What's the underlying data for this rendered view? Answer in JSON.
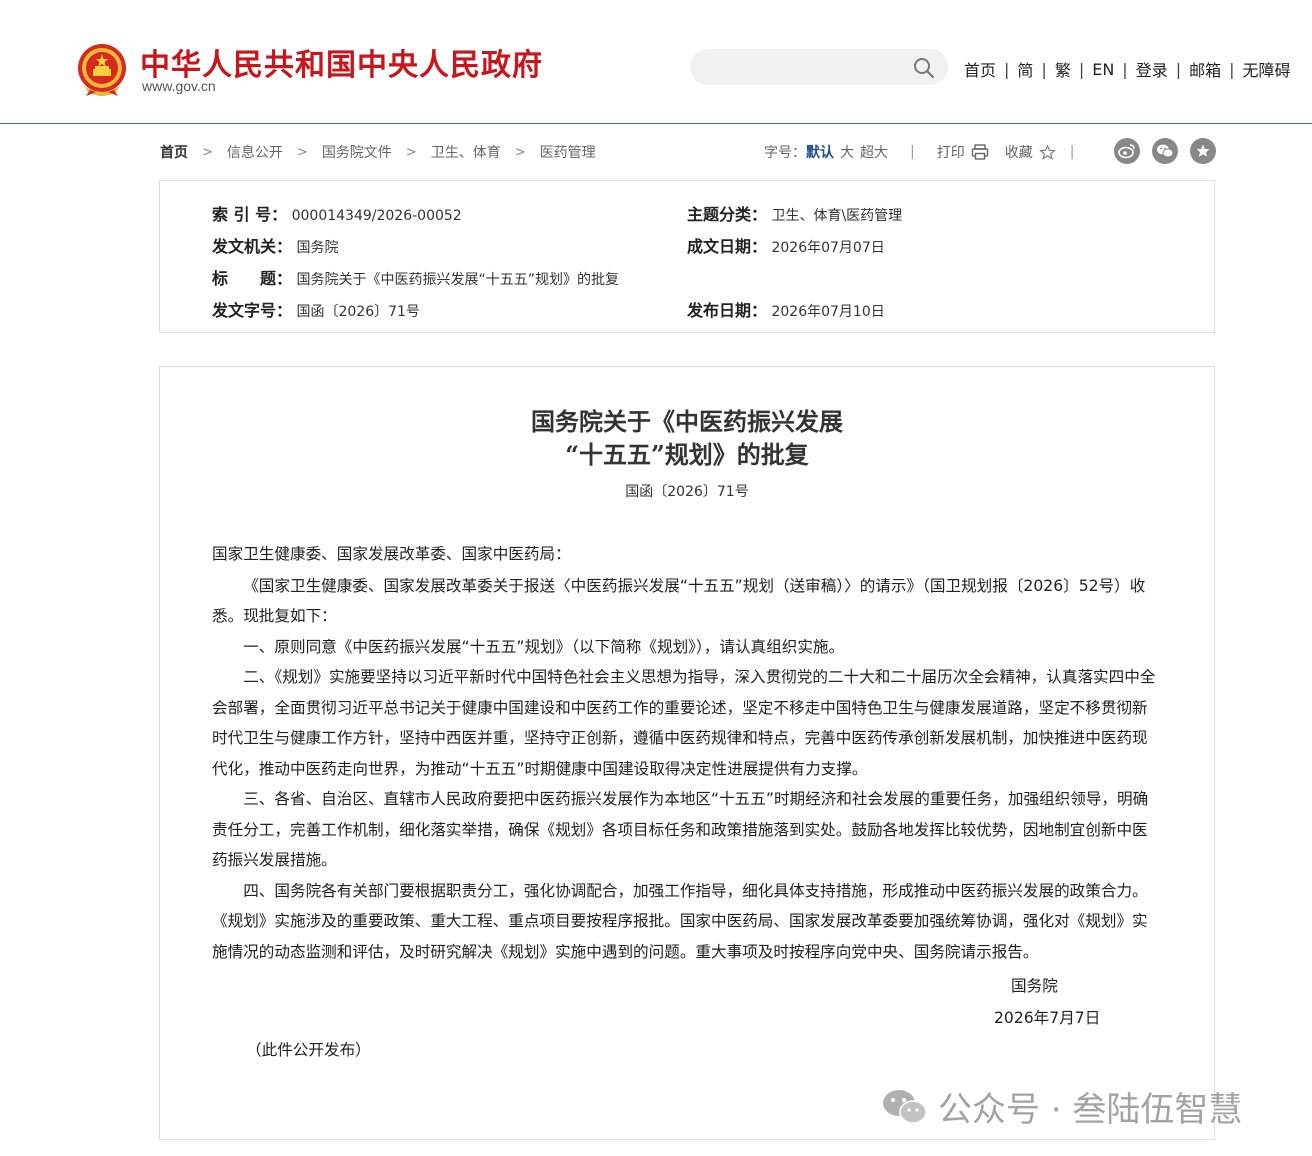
{
  "header": {
    "site_title": "中华人民共和国中央人民政府",
    "site_url": "www.gov.cn",
    "search_placeholder": "",
    "nav": [
      "首页",
      "简",
      "繁",
      "EN",
      "登录",
      "邮箱",
      "无障碍"
    ]
  },
  "breadcrumb": [
    "首页",
    "信息公开",
    "国务院文件",
    "卫生、体育",
    "医药管理"
  ],
  "tools": {
    "font_size_label": "字号：",
    "font_sizes": [
      "默认",
      "大",
      "超大"
    ],
    "print": "打印",
    "favorite": "收藏"
  },
  "social_icons": [
    "weibo-icon",
    "wechat-icon",
    "favorite-star-icon"
  ],
  "info": {
    "index_no": {
      "label": "索 引 号：",
      "value": "000014349/2026-00052"
    },
    "topic": {
      "label": "主题分类：",
      "value": "卫生、体育\\医药管理"
    },
    "issuer": {
      "label": "发文机关：",
      "value": "国务院"
    },
    "written_date": {
      "label": "成文日期：",
      "value": "2026年07月07日"
    },
    "title": {
      "label": "标　　题：",
      "value": "国务院关于《中医药振兴发展“十五五”规划》的批复"
    },
    "doc_no": {
      "label": "发文字号：",
      "value": "国函〔2026〕71号"
    },
    "publish_date": {
      "label": "发布日期：",
      "value": "2026年07月10日"
    }
  },
  "article": {
    "title_line1": "国务院关于《中医药振兴发展",
    "title_line2": "“十五五”规划》的批复",
    "doc_no": "国函〔2026〕71号",
    "greeting": "国家卫生健康委、国家发展改革委、国家中医药局：",
    "paragraphs": [
      "《国家卫生健康委、国家发展改革委关于报送〈中医药振兴发展“十五五”规划（送审稿）〉的请示》（国卫规划报〔2026〕52号）收悉。现批复如下：",
      "一、原则同意《中医药振兴发展“十五五”规划》（以下简称《规划》），请认真组织实施。",
      "二、《规划》实施要坚持以习近平新时代中国特色社会主义思想为指导，深入贯彻党的二十大和二十届历次全会精神，认真落实四中全会部署，全面贯彻习近平总书记关于健康中国建设和中医药工作的重要论述，坚定不移走中国特色卫生与健康发展道路，坚定不移贯彻新时代卫生与健康工作方针，坚持中西医并重，坚持守正创新，遵循中医药规律和特点，完善中医药传承创新发展机制，加快推进中医药现代化，推动中医药走向世界，为推动“十五五”时期健康中国建设取得决定性进展提供有力支撑。",
      "三、各省、自治区、直辖市人民政府要把中医药振兴发展作为本地区“十五五”时期经济和社会发展的重要任务，加强组织领导，明确责任分工，完善工作机制，细化落实举措，确保《规划》各项目标任务和政策措施落到实处。鼓励各地发挥比较优势，因地制宜创新中医药振兴发展措施。",
      "四、国务院各有关部门要根据职责分工，强化协调配合，加强工作指导，细化具体支持措施，形成推动中医药振兴发展的政策合力。《规划》实施涉及的重要政策、重大工程、重点项目要按程序报批。国家中医药局、国家发展改革委要加强统筹协调，强化对《规划》实施情况的动态监测和评估，及时研究解决《规划》实施中遇到的问题。重大事项及时按程序向党中央、国务院请示报告。"
    ],
    "signature": "国务院",
    "date": "2026年7月7日",
    "note": "（此件公开发布）"
  },
  "watermark": "公众号 · 叁陆伍智慧",
  "colors": {
    "brand_red": "#c8161d",
    "header_line": "#4a6d96",
    "active_blue": "#1d4f91"
  }
}
